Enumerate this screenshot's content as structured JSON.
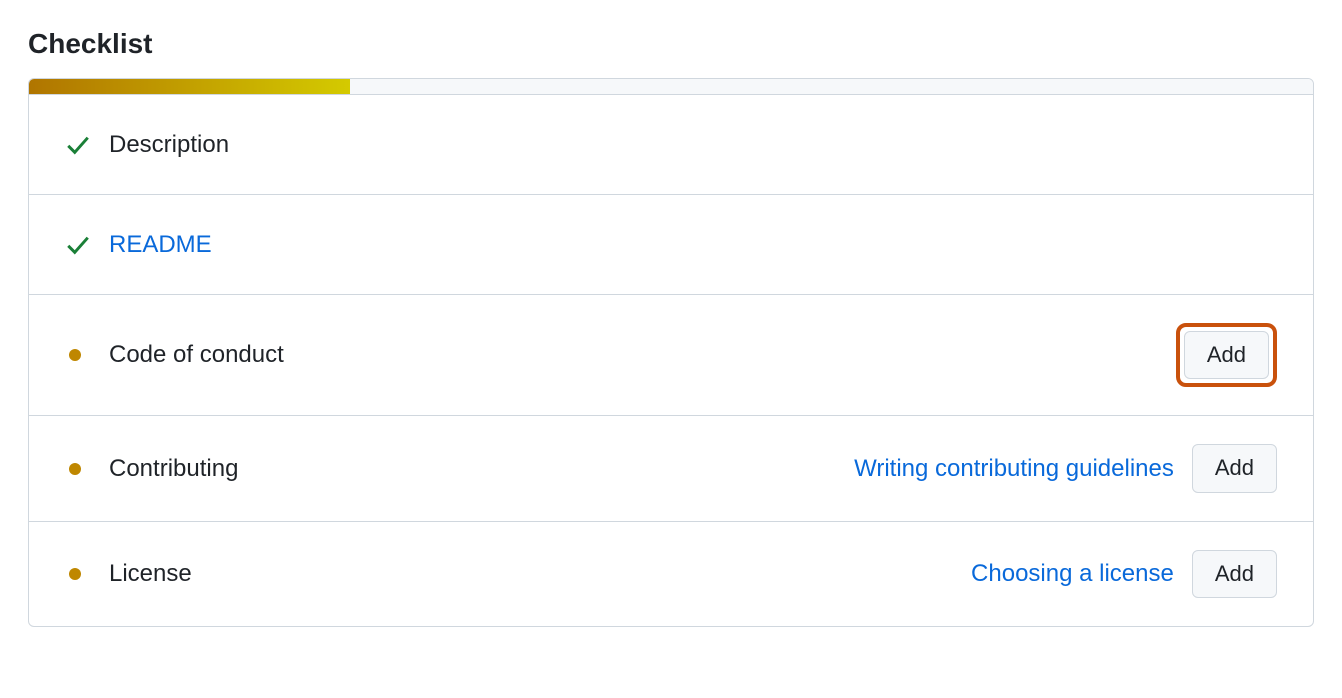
{
  "heading": "Checklist",
  "progress": {
    "percent": 25
  },
  "items": [
    {
      "status": "done",
      "label": "Description",
      "is_link": false
    },
    {
      "status": "done",
      "label": "README",
      "is_link": true
    },
    {
      "status": "pending",
      "label": "Code of conduct",
      "action": "Add",
      "highlighted": true
    },
    {
      "status": "pending",
      "label": "Contributing",
      "help_text": "Writing contributing guidelines",
      "action": "Add"
    },
    {
      "status": "pending",
      "label": "License",
      "help_text": "Choosing a license",
      "action": "Add"
    }
  ]
}
